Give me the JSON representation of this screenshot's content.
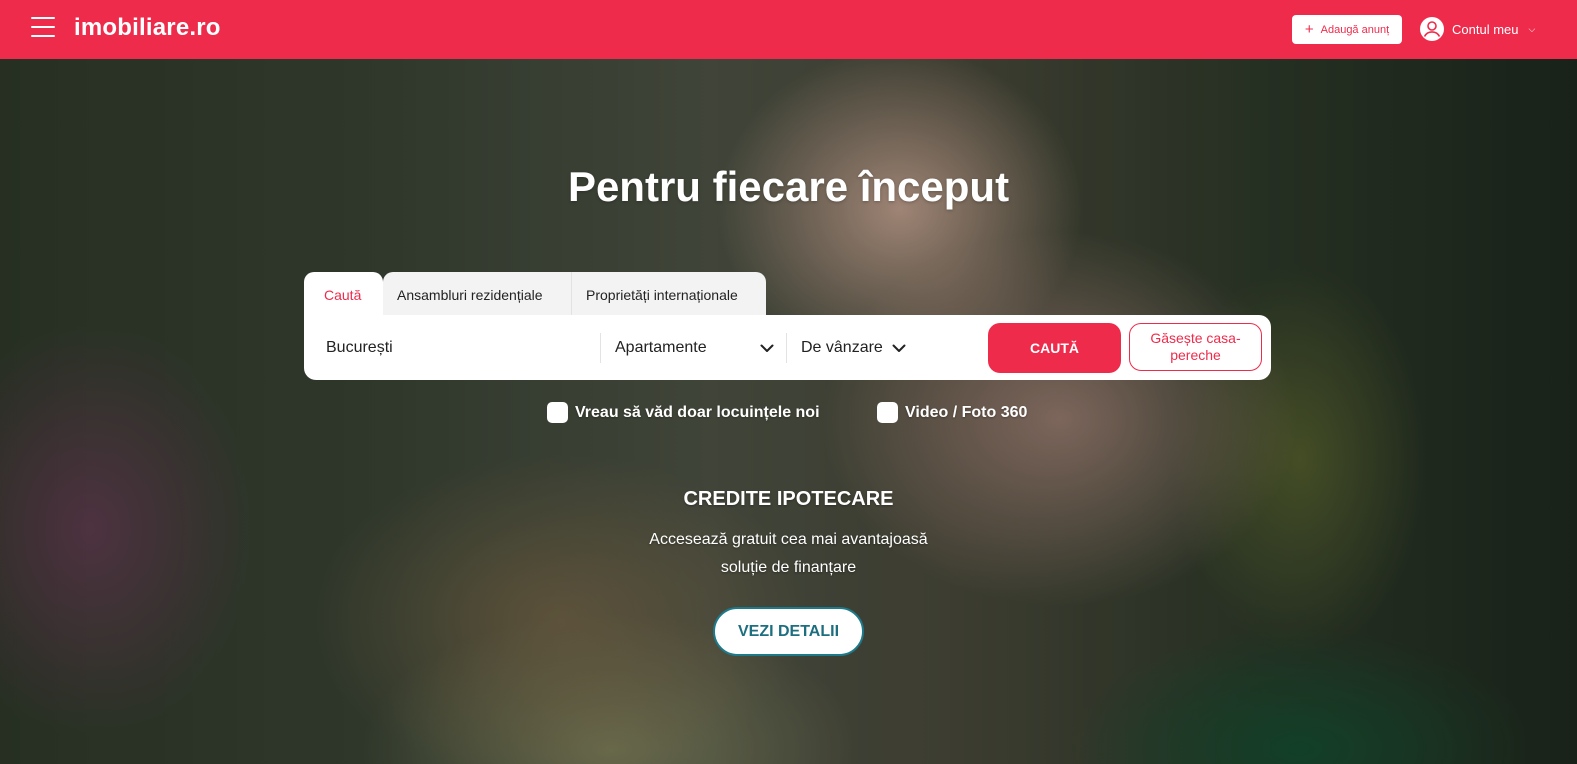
{
  "header": {
    "logo": "imobiliare.ro",
    "add_listing_label": "Adaugă anunț",
    "account_label": "Contul meu",
    "brand_color": "#ee2b4b"
  },
  "hero": {
    "headline": "Pentru fiecare început"
  },
  "search": {
    "tabs": [
      {
        "label": "Caută",
        "active": true
      },
      {
        "label": "Ansambluri rezidențiale",
        "active": false
      },
      {
        "label": "Proprietăți internaționale",
        "active": false
      }
    ],
    "location_value": "București",
    "property_type": "Apartamente",
    "transaction_type": "De vânzare",
    "search_button": "CAUTĂ",
    "match_button": "Găsește casa-pereche"
  },
  "filters": {
    "new_only": "Vreau să văd doar locuințele noi",
    "video_360": "Video / Foto 360"
  },
  "promo": {
    "title": "CREDITE IPOTECARE",
    "line1": "Accesează gratuit cea mai avantajoasă",
    "line2": "soluție de finanțare",
    "button": "VEZI DETALII"
  },
  "icons": {
    "menu": "hamburger-icon",
    "plus": "plus-icon",
    "user": "user-icon",
    "chevron": "chevron-down-icon"
  }
}
